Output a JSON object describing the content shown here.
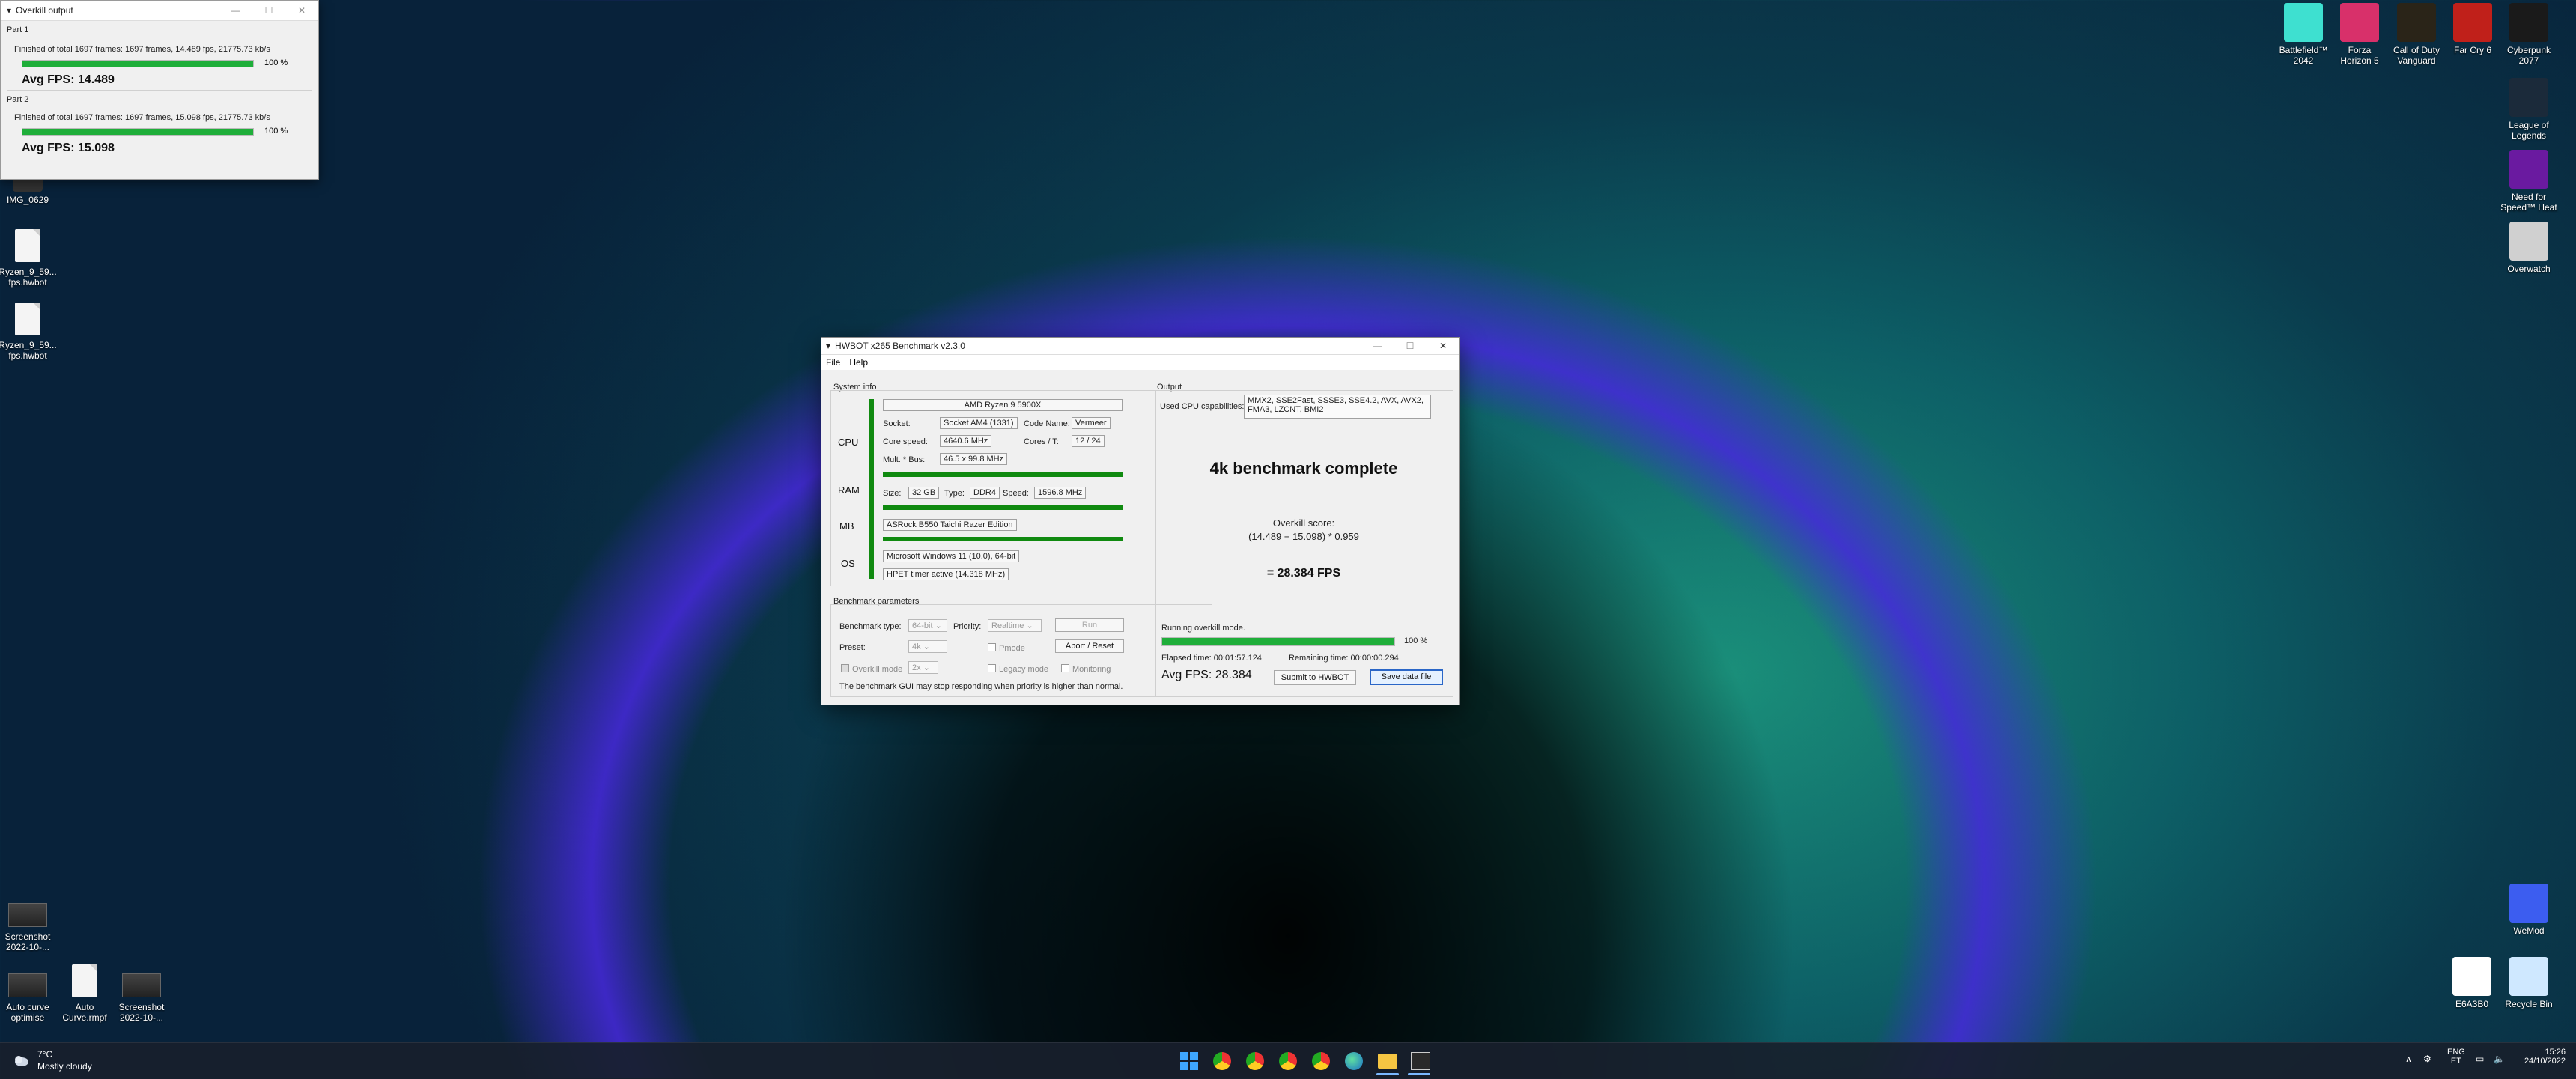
{
  "desktop": {
    "left_icons": [
      {
        "label": "IMG_0629",
        "kind": "image"
      },
      {
        "label": "Ryzen_9_59...\nfps.hwbot",
        "kind": "doc"
      },
      {
        "label": "Ryzen_9_59...\nfps.hwbot",
        "kind": "doc"
      },
      {
        "label": "Screenshot\n2022-10-...",
        "kind": "shot"
      },
      {
        "label": "Auto curve\noptimise",
        "kind": "shot"
      },
      {
        "label": "Auto\nCurve.rmpf",
        "kind": "doc"
      },
      {
        "label": "Screenshot\n2022-10-...",
        "kind": "shot"
      }
    ],
    "right_icons": [
      {
        "label": "Battlefield™\n2042",
        "color": "#3ee0d0"
      },
      {
        "label": "Forza\nHorizon 5",
        "color": "#d8306a"
      },
      {
        "label": "Call of Duty\nVanguard",
        "color": "#2a2418"
      },
      {
        "label": "Far Cry 6",
        "color": "#c0201a"
      },
      {
        "label": "Cyberpunk\n2077",
        "color": "#1a1a1a"
      },
      {
        "label": "League of\nLegends",
        "color": "#1b2a3a"
      },
      {
        "label": "Need for\nSpeed™ Heat",
        "color": "#6a1aa0"
      },
      {
        "label": "Overwatch",
        "color": "#d0d0d0"
      },
      {
        "label": "WeMod",
        "color": "#3c5df0"
      },
      {
        "label": "E6A3B0",
        "color": "#ffffff"
      },
      {
        "label": "Recycle Bin",
        "color": "#cfe8ff"
      }
    ]
  },
  "overkill_window": {
    "title": "Overkill output",
    "parts": [
      {
        "label": "Part 1",
        "status": "Finished of total 1697 frames: 1697 frames, 14.489 fps,  21775.73 kb/s",
        "progress": 100,
        "progress_label": "100 %",
        "avg": "Avg FPS: 14.489"
      },
      {
        "label": "Part 2",
        "status": "Finished of total 1697 frames: 1697 frames, 15.098 fps,  21775.73 kb/s",
        "progress": 100,
        "progress_label": "100 %",
        "avg": "Avg FPS: 15.098"
      }
    ]
  },
  "main_window": {
    "title": "HWBOT x265 Benchmark v2.3.0",
    "menu": [
      "File",
      "Help"
    ],
    "system_info": {
      "label": "System info",
      "cpu_label": "CPU",
      "cpu_name": "AMD Ryzen 9 5900X",
      "socket_label": "Socket:",
      "socket": "Socket AM4 (1331)",
      "codename_label": "Code Name:",
      "codename": "Vermeer",
      "corespeed_label": "Core speed:",
      "corespeed": "4640.6 MHz",
      "cores_label": "Cores / T:",
      "cores": "12 / 24",
      "mult_label": "Mult. * Bus:",
      "mult": "46.5 x 99.8 MHz",
      "ram_label": "RAM",
      "size_label": "Size:",
      "size": "32 GB",
      "type_label": "Type:",
      "type": "DDR4",
      "speed_label": "Speed:",
      "speed": "1596.8 MHz",
      "mb_label": "MB",
      "mb": "ASRock B550 Taichi Razer Edition",
      "os_label": "OS",
      "os": "Microsoft Windows 11 (10.0), 64-bit",
      "timer": "HPET timer active (14.318 MHz)"
    },
    "params": {
      "label": "Benchmark parameters",
      "type_label": "Benchmark type:",
      "type_value": "64-bit",
      "priority_label": "Priority:",
      "priority_value": "Realtime",
      "run_label": "Run",
      "preset_label": "Preset:",
      "preset_value": "4k",
      "pmode_label": "Pmode",
      "abort_label": "Abort / Reset",
      "overkill_label": "Overkill mode",
      "overkill_value": "2x",
      "legacy_label": "Legacy mode",
      "monitoring_label": "Monitoring",
      "note": "The benchmark GUI may stop responding when priority is higher than normal."
    },
    "output": {
      "label": "Output",
      "caps_label": "Used CPU capabilities:",
      "caps": "MMX2, SSE2Fast, SSSE3, SSE4.2, AVX, AVX2,\nFMA3, LZCNT, BMI2",
      "headline": "4k benchmark complete",
      "score_label": "Overkill score:",
      "score_formula": "(14.489 + 15.098) * 0.959",
      "score_result": "= 28.384 FPS",
      "running_label": "Running overkill mode.",
      "progress": 100,
      "progress_label": "100 %",
      "elapsed": "Elapsed time: 00:01:57.124",
      "remaining": "Remaining time: 00:00:00.294",
      "avg": "Avg FPS: 28.384",
      "submit_label": "Submit to HWBOT",
      "save_label": "Save data file"
    }
  },
  "taskbar": {
    "weather_temp": "7°C",
    "weather_desc": "Mostly cloudy",
    "lang": "ENG",
    "region": "ET",
    "time": "15:26",
    "date": "24/10/2022"
  }
}
